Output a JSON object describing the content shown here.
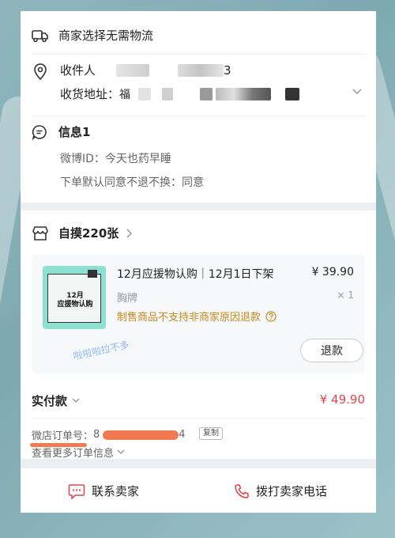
{
  "shipping": {
    "text": "商家选择无需物流"
  },
  "recipient": {
    "name_label": "收件人",
    "name_tail": "3",
    "address_label": "收货地址：",
    "address_head": "福"
  },
  "info": {
    "title": "信息1",
    "weibo": "微博ID：今天也药早睡",
    "agree": "下单默认同意不退不换：同意"
  },
  "shop": {
    "name": "自摸220张"
  },
  "item": {
    "title": "12月应援物认购｜12月1日下架",
    "price": "¥ 39.90",
    "spec": "胸牌",
    "qty": "× 1",
    "notice": "制售商品不支持非商家原因退款",
    "refund_label": "退款",
    "thumb_text": "12月\n应援物认购"
  },
  "payment": {
    "label": "实付款",
    "amount": "¥ 49.90"
  },
  "order": {
    "no_label": "微店订单号：",
    "no_head": "8",
    "no_tail": "4",
    "copy_label": "复制",
    "more_label": "查看更多订单信息"
  },
  "actions": {
    "contact": "联系卖家",
    "call": "拨打卖家电话"
  },
  "watermark": "啦啦啦拉不多",
  "colors": {
    "accent": "#e0484c",
    "warning": "#c98a1c",
    "blur_red": "#f07a52"
  }
}
